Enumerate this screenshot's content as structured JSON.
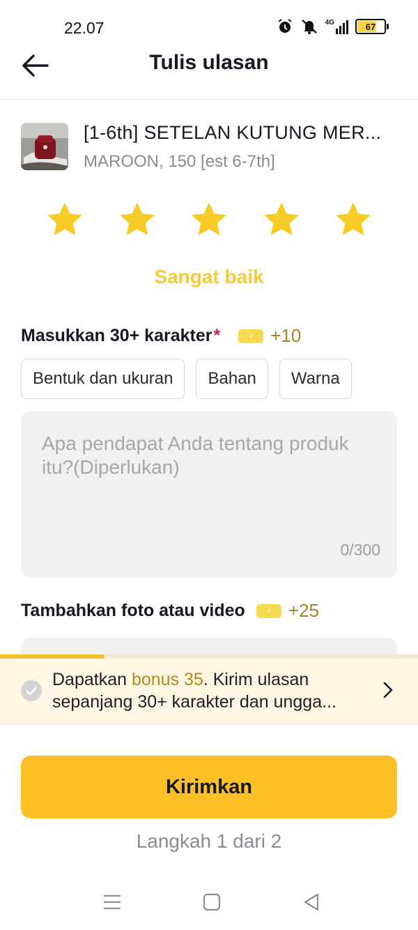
{
  "status_bar": {
    "time": "22.07",
    "battery": "67",
    "network": "4G"
  },
  "header": {
    "title": "Tulis ulasan"
  },
  "product": {
    "name": "[1-6th] SETELAN KUTUNG MER...",
    "variant": "MAROON, 150 [est 6-7th]"
  },
  "rating": {
    "stars": 5,
    "max": 5,
    "label": "Sangat baik",
    "color": "#f6cb36"
  },
  "review": {
    "label": "Masukkan 30+ karakter",
    "required_mark": "*",
    "bonus": "+10",
    "chips": [
      "Bentuk dan ukuran",
      "Bahan",
      "Warna"
    ],
    "placeholder": "Apa pendapat Anda tentang produk itu?(Diperlukan)",
    "counter": "0/300"
  },
  "media": {
    "label": "Tambahkan foto atau video",
    "bonus": "+25"
  },
  "banner": {
    "prefix": "Dapatkan ",
    "highlight": "bonus 35",
    "suffix": ". Kirim ulasan",
    "line2": "sepanjang 30+ karakter dan ungga..."
  },
  "submit": {
    "label": "Kirimkan",
    "step": "Langkah 1 dari 2"
  },
  "icons": [
    "back-arrow-icon",
    "star-icon",
    "coin-icon",
    "check-circle-icon",
    "chevron-right-icon",
    "alarm-icon",
    "mute-icon",
    "signal-icon",
    "battery-icon",
    "menu-nav-icon",
    "home-nav-icon",
    "back-nav-icon"
  ],
  "colors": {
    "accent": "#fcc026",
    "star": "#f6cb36",
    "bonus_text": "#a68325",
    "banner_bg": "#fdf6e3"
  }
}
